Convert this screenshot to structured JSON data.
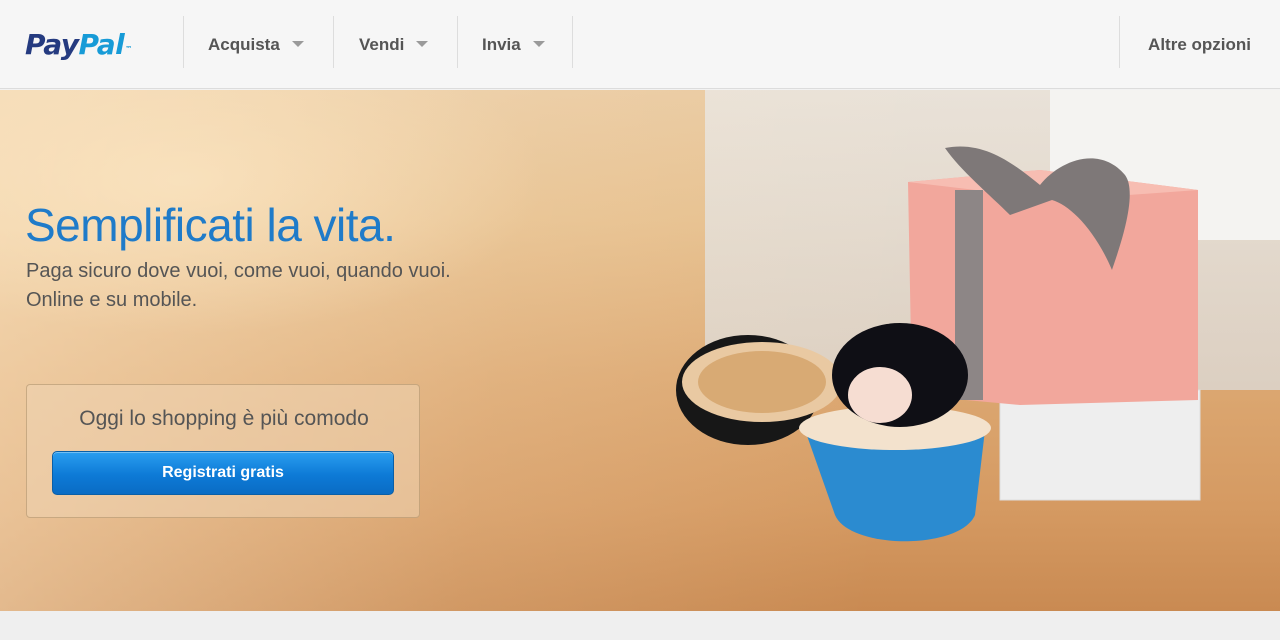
{
  "brand": {
    "name_part1": "Pay",
    "name_part2": "Pal",
    "tm": "™"
  },
  "nav": {
    "items": [
      {
        "label": "Acquista"
      },
      {
        "label": "Vendi"
      },
      {
        "label": "Invia"
      }
    ],
    "more_label": "Altre opzioni"
  },
  "hero": {
    "headline": "Semplificati la vita.",
    "subline1": "Paga sicuro dove vuoi, come vuoi, quando vuoi.",
    "subline2": "Online e su mobile."
  },
  "cta": {
    "title": "Oggi lo shopping è più comodo",
    "button_label": "Registrati gratis"
  },
  "colors": {
    "brand_dark": "#253b80",
    "brand_light": "#179bd7",
    "headline": "#1f7bc9",
    "button": "#0d7ad6"
  }
}
